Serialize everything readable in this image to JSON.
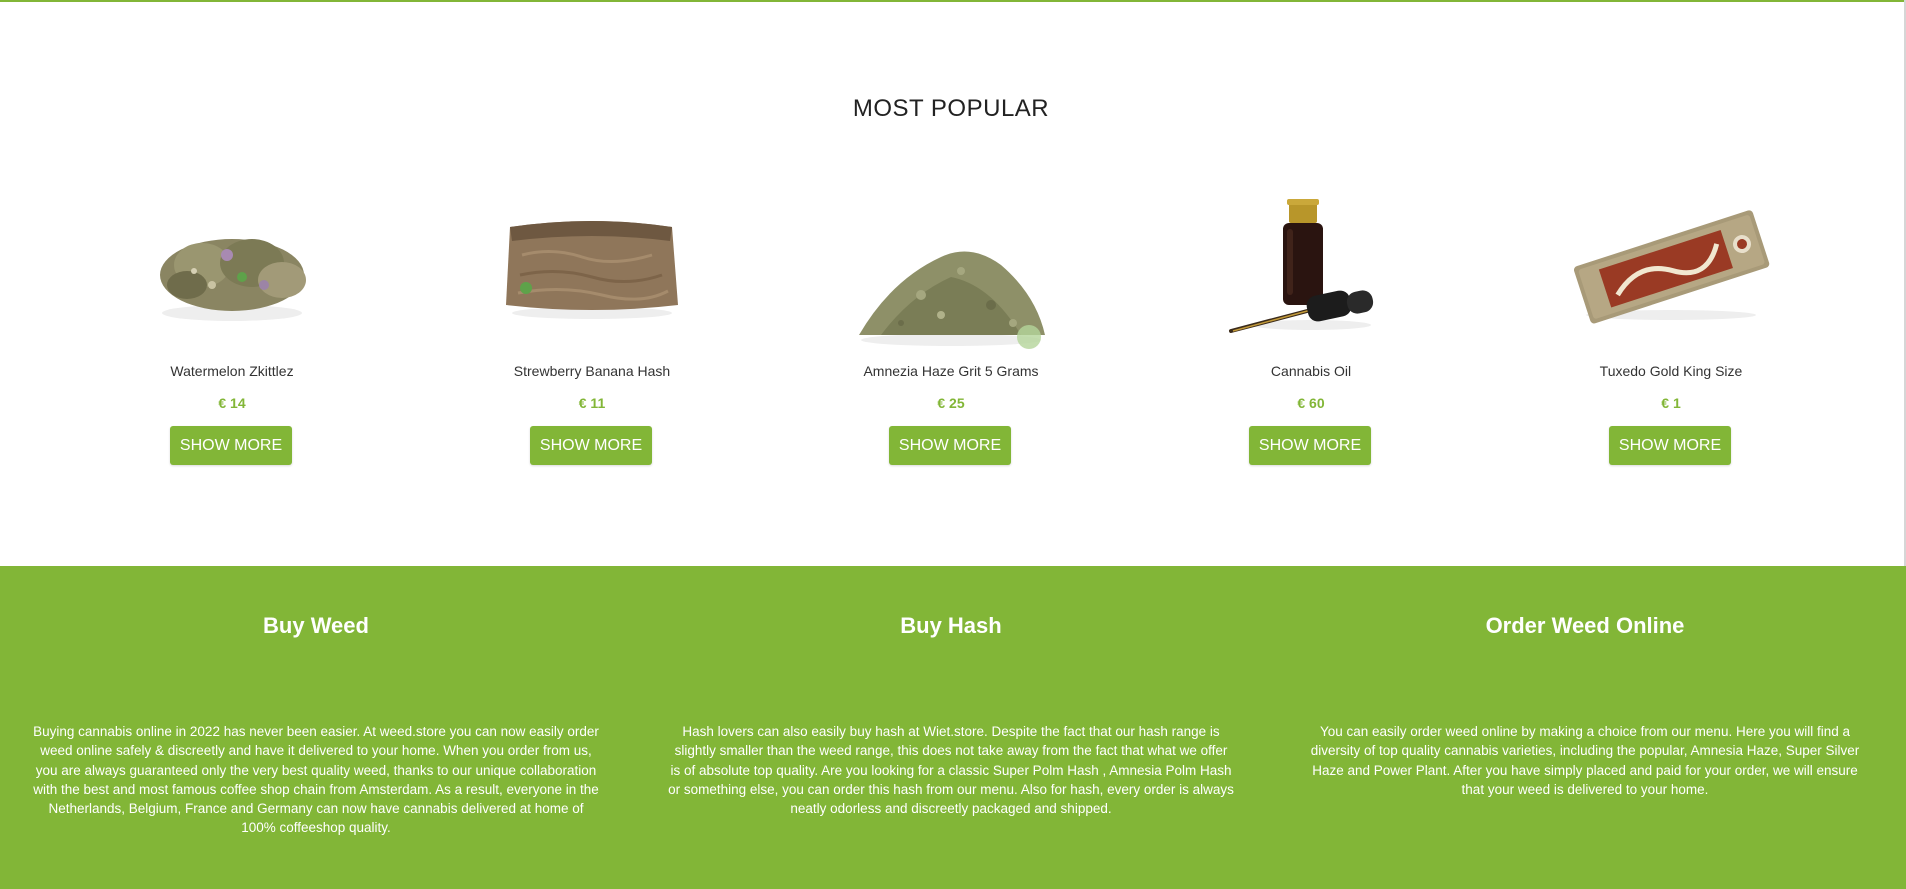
{
  "section_title": "MOST POPULAR",
  "products": [
    {
      "name": "Watermelon Zkittlez",
      "price": "€ 14",
      "button": "SHOW MORE",
      "image_icon": "cannabis-bud-image"
    },
    {
      "name": "Strewberry Banana Hash",
      "price": "€ 11",
      "button": "SHOW MORE",
      "image_icon": "hash-block-image"
    },
    {
      "name": "Amnezia Haze Grit 5 Grams",
      "price": "€ 25",
      "button": "SHOW MORE",
      "image_icon": "cannabis-grit-image"
    },
    {
      "name": "Cannabis Oil",
      "price": "€ 60",
      "button": "SHOW MORE",
      "image_icon": "oil-bottle-image"
    },
    {
      "name": "Tuxedo Gold King Size",
      "price": "€ 1",
      "button": "SHOW MORE",
      "image_icon": "rolling-papers-image"
    }
  ],
  "info_columns": [
    {
      "title": "Buy Weed",
      "text": "Buying cannabis online in 2022 has never been easier. At weed.store you can now easily order weed online safely & discreetly and have it delivered to your home. When you order from us, you are always guaranteed only the very best quality weed, thanks to our unique collaboration with the best and most famous coffee shop chain from Amsterdam. As a result, everyone in the Netherlands, Belgium, France and Germany can now have cannabis delivered at home of 100% coffeeshop quality."
    },
    {
      "title": "Buy Hash",
      "text": "Hash lovers can also easily buy hash at Wiet.store. Despite the fact that our hash range is slightly smaller than the weed range, this does not take away from the fact that what we offer is of absolute top quality. Are you looking for a classic Super Polm Hash , Amnesia Polm Hash or something else, you can order this hash from our menu. Also for hash, every order is always neatly odorless and discreetly packaged and shipped."
    },
    {
      "title": "Order Weed Online",
      "text": "You can easily order weed online by making a choice from our menu. Here you will find a diversity of top quality cannabis varieties, including the popular, Amnesia Haze, Super Silver Haze and Power Plant. After you have simply placed and paid for your order, we will ensure that your weed is delivered to your home."
    }
  ],
  "colors": {
    "accent": "#82b637",
    "text": "#333333",
    "white": "#ffffff"
  }
}
